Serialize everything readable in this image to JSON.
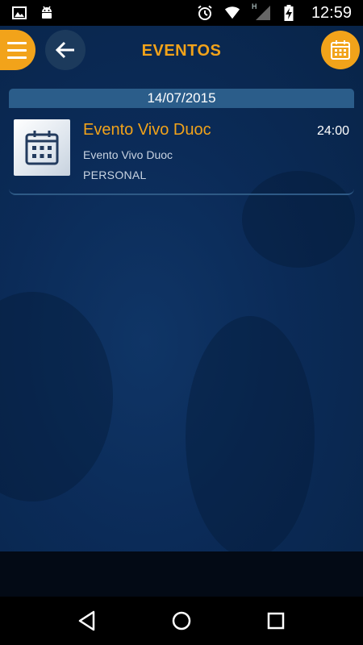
{
  "status_bar": {
    "time": "12:59",
    "left_icons": [
      "image-icon",
      "android-icon"
    ],
    "right_icons": [
      "alarm-icon",
      "wifi-icon",
      "h-signal-icon",
      "signal-icon",
      "battery-charging-icon"
    ]
  },
  "app_bar": {
    "title": "EVENTOS",
    "menu_icon": "hamburger-icon",
    "back_icon": "arrow-left-icon",
    "calendar_icon": "calendar-icon"
  },
  "events_list": {
    "date": "14/07/2015",
    "items": [
      {
        "title": "Evento Vivo Duoc",
        "subtitle": "Evento Vivo Duoc",
        "type": "PERSONAL",
        "time": "24:00",
        "icon": "calendar-icon"
      }
    ]
  },
  "nav_bar": {
    "icons": [
      "back-triangle-icon",
      "home-circle-icon",
      "recents-square-icon"
    ]
  },
  "colors": {
    "accent": "#f2a31a",
    "background": "#0b2a54",
    "date_header": "#2b5d8a"
  }
}
